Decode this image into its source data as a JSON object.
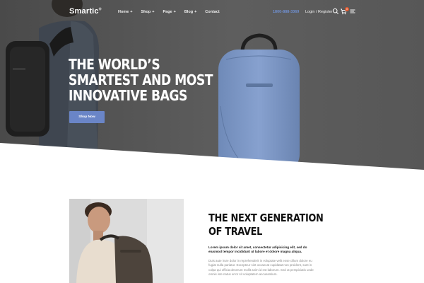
{
  "nav": {
    "logo": "Smartic",
    "logo_mark": "®",
    "menu": [
      {
        "label": "Home",
        "plus": "+"
      },
      {
        "label": "Shop",
        "plus": "+"
      },
      {
        "label": "Page",
        "plus": "+"
      },
      {
        "label": "Blog",
        "plus": "+"
      },
      {
        "label": "Contact",
        "plus": ""
      }
    ],
    "phone": "1800-888-3369",
    "login": "Login / Register",
    "cart_count": "0",
    "icons": [
      "search-icon",
      "cart-icon",
      "menu-icon"
    ]
  },
  "hero": {
    "title_lines": [
      "THE WORLD’S",
      "SMARTEST AND MOST",
      "INNOVATIVE BAGS"
    ],
    "cta": "Shop Now"
  },
  "feature": {
    "title_lines": [
      "THE NEXT GENERATION",
      "OF TRAVEL"
    ],
    "lead": "Lorem ipsum dolor sit amet, consectetur adipisicing elit, sed do eiusmod tempor incididunt ut labore et dolore magna aliqua.",
    "body": "Duis aute irure dolor in reprehenderit in voluptate velit esse cillum dolore eu fugiat nulla pariatur. Excepteur sint occaecat cupidatat non proident, sunt in culpa qui officia deserunt mollit anim id est laborum. Sed ut perspiciatis unde omnis iste natus error sit voluptatem accusantium."
  },
  "colors": {
    "hero_bg": "#5a5a5a",
    "accent": "#6a85c7",
    "badge": "#e0572d",
    "phone": "#6f8fcf"
  }
}
